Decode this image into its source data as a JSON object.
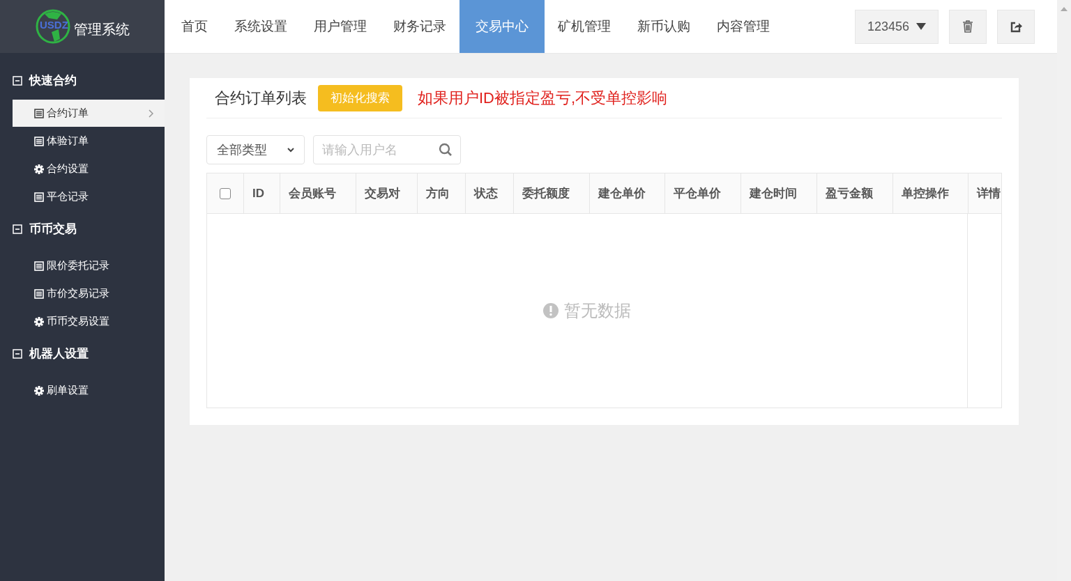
{
  "logo": {
    "brand": "USDZ",
    "title": "管理系统"
  },
  "nav": [
    {
      "label": "首页",
      "selected": false
    },
    {
      "label": "系统设置",
      "selected": false
    },
    {
      "label": "用户管理",
      "selected": false
    },
    {
      "label": "财务记录",
      "selected": false
    },
    {
      "label": "交易中心",
      "selected": true
    },
    {
      "label": "矿机管理",
      "selected": false
    },
    {
      "label": "新币认购",
      "selected": false
    },
    {
      "label": "内容管理",
      "selected": false
    }
  ],
  "user_menu": {
    "label": "123456"
  },
  "sidebar": [
    {
      "label": "快速合约",
      "expanded": true,
      "children": [
        {
          "label": "合约订单",
          "kind": "list",
          "selected": true
        },
        {
          "label": "体验订单",
          "kind": "list",
          "selected": false
        },
        {
          "label": "合约设置",
          "kind": "gear",
          "selected": false
        },
        {
          "label": "平仓记录",
          "kind": "list",
          "selected": false
        }
      ]
    },
    {
      "label": "币币交易",
      "expanded": true,
      "children": [
        {
          "label": "限价委托记录",
          "kind": "list",
          "selected": false
        },
        {
          "label": "市价交易记录",
          "kind": "list",
          "selected": false
        },
        {
          "label": "币币交易设置",
          "kind": "gear",
          "selected": false
        }
      ]
    },
    {
      "label": "机器人设置",
      "expanded": true,
      "children": [
        {
          "label": "刷单设置",
          "kind": "gear",
          "selected": false
        }
      ]
    }
  ],
  "panel": {
    "title": "合约订单列表",
    "reset_button": "初始化搜索",
    "notice": "如果用户ID被指定盈亏,不受单控影响",
    "type_select": "全部类型",
    "search": {
      "placeholder": "请输入用户名"
    },
    "table": {
      "select_all_checked": false,
      "columns": [
        "ID",
        "会员账号",
        "交易对",
        "方向",
        "状态",
        "委托额度",
        "建仓单价",
        "平仓单价",
        "建仓时间",
        "盈亏金额",
        "单控操作",
        "详情"
      ],
      "empty_text": "暂无数据"
    }
  }
}
